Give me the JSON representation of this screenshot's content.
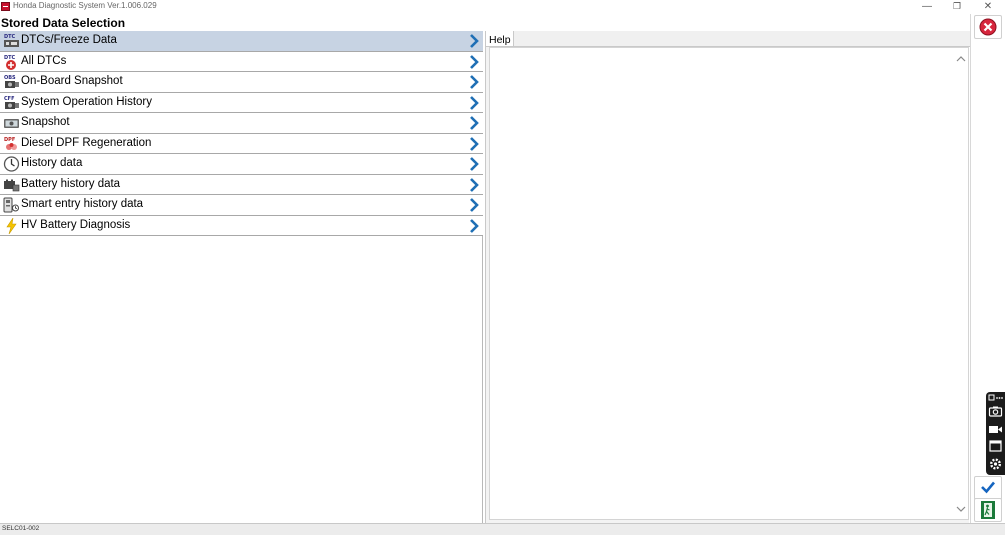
{
  "window": {
    "title": "Honda Diagnostic System Ver.1.006.029",
    "controls": {
      "minimize": "—",
      "restore": "❐",
      "close": "✕"
    }
  },
  "page": {
    "title": "Stored Data Selection"
  },
  "menu": {
    "selected_index": 0,
    "items": [
      {
        "label": "DTCs/Freeze Data",
        "icon": "dtc-freeze-icon"
      },
      {
        "label": "All DTCs",
        "icon": "all-dtcs-icon"
      },
      {
        "label": "On-Board Snapshot",
        "icon": "obs-icon"
      },
      {
        "label": "System Operation History",
        "icon": "cff-icon"
      },
      {
        "label": "Snapshot",
        "icon": "snapshot-icon"
      },
      {
        "label": "Diesel DPF Regeneration",
        "icon": "dpf-icon"
      },
      {
        "label": "History data",
        "icon": "clock-icon"
      },
      {
        "label": "Battery history data",
        "icon": "battery-icon"
      },
      {
        "label": "Smart entry history data",
        "icon": "smart-entry-icon"
      },
      {
        "label": "HV Battery Diagnosis",
        "icon": "lightning-icon"
      }
    ]
  },
  "help": {
    "tab_label": "Help"
  },
  "status": {
    "screen_code": "SELC01-002"
  },
  "icon_text": {
    "dtc": "DTC",
    "obs": "OBS",
    "cff": "CFF",
    "dpf": "DPF"
  },
  "colors": {
    "selected_row": "#c7d3e3",
    "chevron": "#1f6fb5",
    "close_red": "#d7263d",
    "confirm_blue": "#1565c0",
    "exit_green": "#1b7a3a"
  }
}
